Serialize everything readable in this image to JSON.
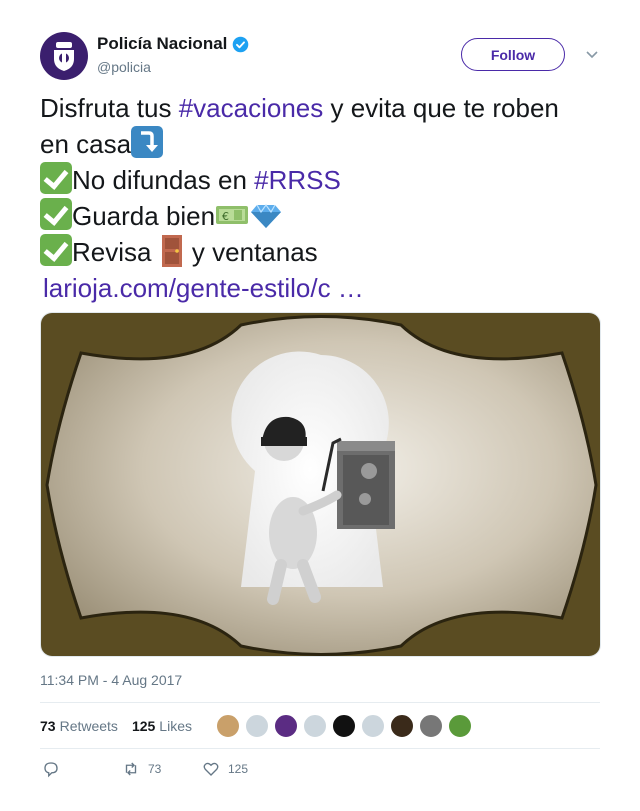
{
  "tweet": {
    "display_name": "Policía Nacional",
    "handle": "@policia",
    "follow_label": "Follow",
    "text": {
      "line1_a": "Disfruta tus ",
      "line1_hashtag": "#vacaciones",
      "line1_b": " y evita que te roben",
      "line2": "en casa",
      "line3_a": "No difundas en ",
      "line3_hashtag": "#RRSS",
      "line4": "Guarda bien",
      "line5_a": "Revisa ",
      "line5_b": " y ventanas",
      "link": "larioja.com/gente-estilo/c …"
    },
    "timestamp": "11:34 PM - 4 Aug 2017",
    "retweets_count": "73",
    "retweets_label": "Retweets",
    "likes_count": "125",
    "likes_label": "Likes",
    "action_retweets": "73",
    "action_likes": "125"
  },
  "colors": {
    "accent": "#4a2aa8",
    "verified": "#1da1f2",
    "check_emoji": "#6ab04c"
  },
  "icons": [
    "verified-badge-icon",
    "chevron-down-icon",
    "reply-icon",
    "retweet-icon",
    "like-icon"
  ]
}
